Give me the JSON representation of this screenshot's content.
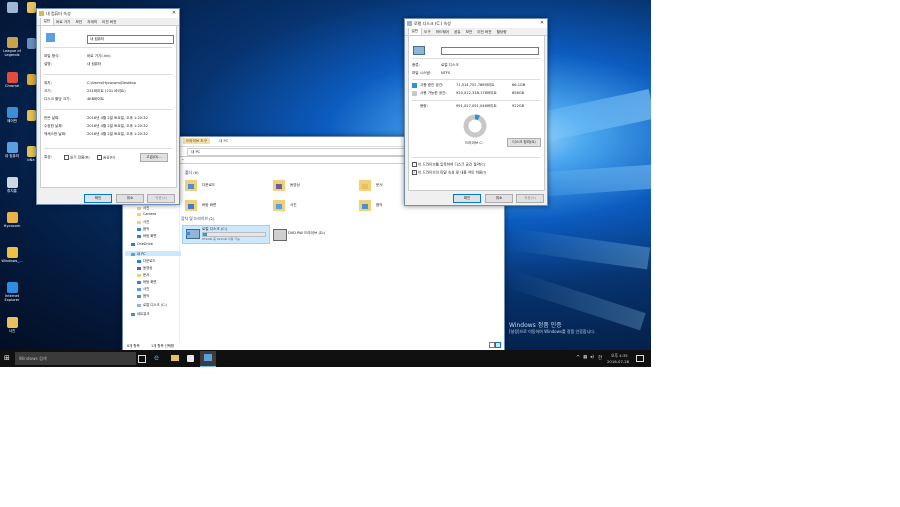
{
  "desktop": {
    "icons": [
      {
        "label": "",
        "color": "#9fb7d6"
      },
      {
        "label": "League of Legends",
        "color": "#c9a24b"
      },
      {
        "label": "Chrome",
        "color": "#e54b3c"
      },
      {
        "label": "제어판",
        "color": "#3b8fd8"
      },
      {
        "label": "내 컴퓨터",
        "color": "#5aa0e0"
      },
      {
        "label": "휴지통",
        "color": "#cfd8e0"
      },
      {
        "label": "Hycocom",
        "color": "#e7b24a"
      },
      {
        "label": "Windows_...",
        "color": "#f0c040"
      },
      {
        "label": "Internet Explorer",
        "color": "#2c8ee0"
      },
      {
        "label": "사진",
        "color": "#e8c060"
      }
    ],
    "icons_col2": [
      {
        "label": "",
        "color": "#e8c060"
      },
      {
        "label": "",
        "color": "#6a8fbf"
      },
      {
        "label": "",
        "color": "#d9ab3a"
      },
      {
        "label": "",
        "color": "#e0c050"
      },
      {
        "label": "bNa",
        "color": "#e0c050"
      }
    ],
    "watermark_title": "Windows 정품 인증",
    "watermark_sub": "[설정]으로 이동하여 Windows를 정품 인증합니다."
  },
  "props_window": {
    "title": "내 컴퓨터 속성",
    "tabs": [
      "일반",
      "바로 가기",
      "보안",
      "자세히",
      "이전 버전"
    ],
    "name_value": "내 컴퓨터",
    "rows": [
      {
        "label": "파일 형식:",
        "value": "바로 가기(.lnk)"
      },
      {
        "label": "설명:",
        "value": "내 컴퓨터"
      },
      {
        "label": "위치:",
        "value": "C:\\Users\\Hycocom\\Desktop"
      },
      {
        "label": "크기:",
        "value": "231바이트 (231 바이트)"
      },
      {
        "label": "디스크 할당 크기:",
        "value": "4KB바이트"
      },
      {
        "label": "만든 날짜:",
        "value": "2016년 4월 2일 토요일, 오후 1:20:32"
      },
      {
        "label": "수정한 날짜:",
        "value": "2016년 4월 2일 토요일, 오후 1:20:32"
      },
      {
        "label": "액세스한 날짜:",
        "value": "2016년 4월 2일 토요일, 오후 1:20:32"
      }
    ],
    "attr_label": "특성:",
    "readonly_label": "읽기 전용(R)",
    "hidden_label": "숨김(H)",
    "advanced_btn": "고급(D)...",
    "ok": "확인",
    "cancel": "취소",
    "apply": "적용(A)"
  },
  "disk_window": {
    "title": "로컬 디스크 (C:) 속성",
    "tabs": [
      "일반",
      "도구",
      "하드웨어",
      "공유",
      "보안",
      "이전 버전",
      "할당량"
    ],
    "type_label": "종류:",
    "type_value": "로컬 디스크",
    "fs_label": "파일 시스템:",
    "fs_value": "NTFS",
    "used_label": "사용 중인 공간:",
    "used_bytes": "71,014,752,768바이트",
    "used_gb": "66.1GB",
    "free_label": "사용 가능한 공간:",
    "free_bytes": "920,012,338,176바이트",
    "free_gb": "856GB",
    "total_label": "용량:",
    "total_bytes": "991,027,091,046바이트",
    "total_gb": "922GB",
    "drive_label": "드라이브 C:",
    "cleanup_btn": "디스크 정리(D)",
    "compress_label": "이 드라이브를 압축하여 디스크 공간 절약(C)",
    "index_label": "이 드라이브의 파일 속성 및 내용 색인 허용(I)",
    "ok": "확인",
    "cancel": "취소",
    "apply": "적용(A)",
    "used_color": "#2a93d5",
    "free_color": "#c8c8c8",
    "used_fraction": 0.072
  },
  "explorer": {
    "ribbon_tab": "드라이브 도구",
    "ribbon_tab2": "내 PC",
    "address": "내 PC",
    "folders_header": "폴더 (6)",
    "folders": [
      "다운로드",
      "동영상",
      "문서",
      "바탕 화면",
      "사진",
      "음악"
    ],
    "devices_header": "장치 및 드라이브 (2)",
    "drive_name": "로컬 디스크 (C:)",
    "drive_free": "856GB 중 922GB 사용 가능",
    "drive_fill": 0.07,
    "dvd_name": "DVD RW 드라이브 (D:)",
    "nav": [
      "사진",
      "Camera",
      "사진",
      "음악",
      "바탕 화면",
      "OneDrive",
      "내 PC",
      "다운로드",
      "동영상",
      "문서",
      "바탕 화면",
      "사진",
      "음악",
      "로컬 디스크 (C:)",
      "네트워크"
    ],
    "status_items": "8개 항목",
    "status_selected": "1개 항목 선택함"
  },
  "taskbar": {
    "search_placeholder": "Windows 검색",
    "time": "오후 4:35",
    "date": "2016-07-28",
    "ime": "A",
    "lang": "한"
  }
}
